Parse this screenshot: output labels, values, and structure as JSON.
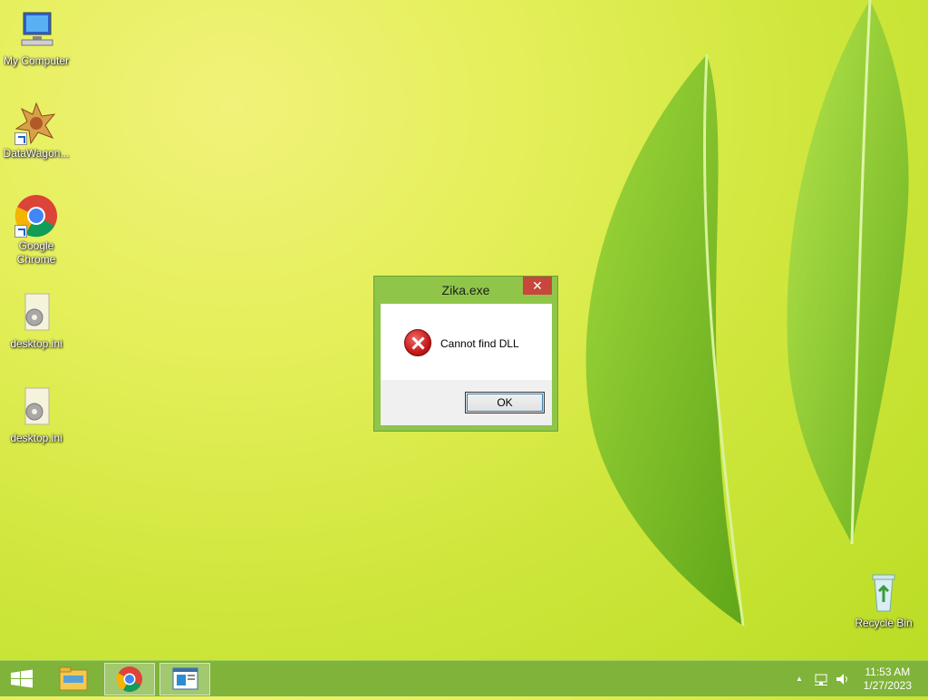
{
  "desktop": {
    "icons": [
      {
        "label": "My Computer"
      },
      {
        "label": "DataWagon..."
      },
      {
        "label": "Google Chrome"
      },
      {
        "label": "desktop.ini"
      },
      {
        "label": "desktop.ini"
      },
      {
        "label": "Recycle Bin"
      }
    ]
  },
  "dialog": {
    "title": "Zika.exe",
    "close_glyph": "✕",
    "message": "Cannot find DLL",
    "ok_label": "OK",
    "icon": "error-icon"
  },
  "taskbar": {
    "items": [
      "start-icon",
      "file-explorer-icon",
      "chrome-icon",
      "app-window-icon"
    ],
    "tray": {
      "chevron": "▲",
      "icons": [
        "network-icon",
        "volume-icon"
      ]
    },
    "clock": {
      "time": "11:53 AM",
      "date": "1/27/2023"
    }
  },
  "colors": {
    "taskbar": "#7fb33a",
    "dialog_frame": "#8fc64a",
    "close_button": "#c7473a"
  }
}
